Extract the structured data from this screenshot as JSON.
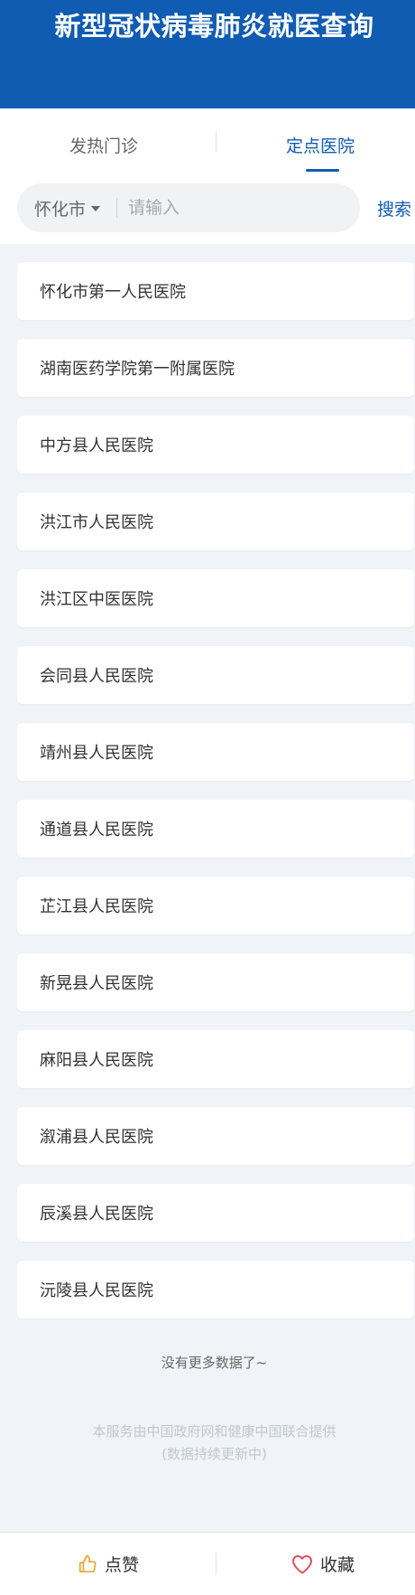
{
  "header": {
    "title": "新型冠状病毒肺炎就医查询",
    "bg_color": "#0f5cb2"
  },
  "tabs": [
    {
      "label": "发热门诊",
      "active": false
    },
    {
      "label": "定点医院",
      "active": true
    }
  ],
  "search": {
    "city": "怀化市",
    "placeholder": "请输入",
    "value": "",
    "button_label": "搜索"
  },
  "hospitals": [
    "怀化市第一人民医院",
    "湖南医药学院第一附属医院",
    "中方县人民医院",
    "洪江市人民医院",
    "洪江区中医医院",
    "会同县人民医院",
    "靖州县人民医院",
    "通道县人民医院",
    "芷江县人民医院",
    "新晃县人民医院",
    "麻阳县人民医院",
    "溆浦县人民医院",
    "辰溪县人民医院",
    "沅陵县人民医院"
  ],
  "no_more": "没有更多数据了~",
  "footer": {
    "line1": "本服务由中国政府网和健康中国联合提供",
    "line2": "(数据持续更新中)"
  },
  "bottom_bar": {
    "like_label": "点赞",
    "favorite_label": "收藏"
  },
  "colors": {
    "accent": "#0f5cb2",
    "like_icon": "#f0a83a",
    "favorite_icon": "#e0505a"
  }
}
